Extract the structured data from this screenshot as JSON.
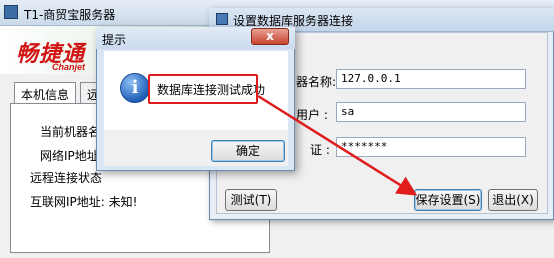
{
  "main_window": {
    "title": "T1-商贸宝服务器",
    "logo_cn": "畅捷通",
    "logo_en": "Chanjet",
    "tabs": [
      {
        "label": "本机信息"
      },
      {
        "label": "远"
      }
    ],
    "info": {
      "machine_name": "当前机器名",
      "network_ip": "网络IP地址",
      "remote_status": "远程连接状态",
      "internet_ip": "互联网IP地址: 未知!"
    }
  },
  "settings_dialog": {
    "title": "设置数据库服务器连接",
    "fields": {
      "server_label": "器名称:",
      "server_value": "127.0.0.1",
      "user_label": "用户 :",
      "user_value": "sa",
      "password_label": "证 :",
      "password_value": "*******"
    },
    "buttons": {
      "test": "测试(T)",
      "save": "保存设置(S)",
      "exit": "退出(X)"
    }
  },
  "message_box": {
    "title": "提示",
    "message": "数据库连接测试成功",
    "ok_button": "确定",
    "close_glyph": "x",
    "icon_glyph": "i"
  },
  "annotation": {
    "color": "#e01c1c"
  }
}
